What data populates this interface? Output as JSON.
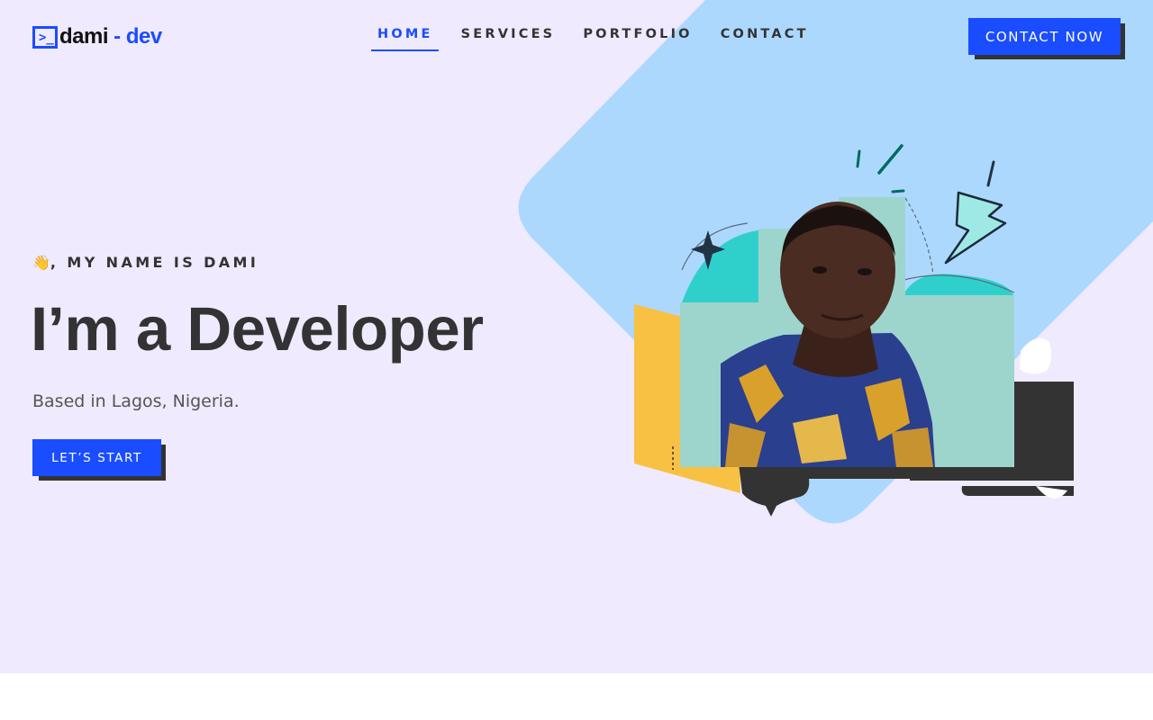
{
  "colors": {
    "hero_bg": "#f0eafe",
    "diamond": "#add8fe",
    "accent": "#1a4dff",
    "dark": "#333333",
    "photo_bg": "#9dd5cd",
    "yellow": "#f8c144",
    "teal": "#2fd0cc"
  },
  "logo": {
    "prompt": ">_",
    "name": "dami",
    "suffix": " - dev"
  },
  "nav": {
    "items": [
      {
        "label": "HOME",
        "active": true
      },
      {
        "label": "SERVICES",
        "active": false
      },
      {
        "label": "PORTFOLIO",
        "active": false
      },
      {
        "label": "CONTACT",
        "active": false
      }
    ]
  },
  "header": {
    "cta_label": "CONTACT NOW"
  },
  "hero": {
    "greeting_icon": "waving-hand-icon",
    "greeting_emoji": "👋",
    "greeting_text": ", MY NAME IS DAMI",
    "headline": "I’m a Developer",
    "location": "Based in Lagos, Nigeria.",
    "cta_label": "LET’S START"
  }
}
